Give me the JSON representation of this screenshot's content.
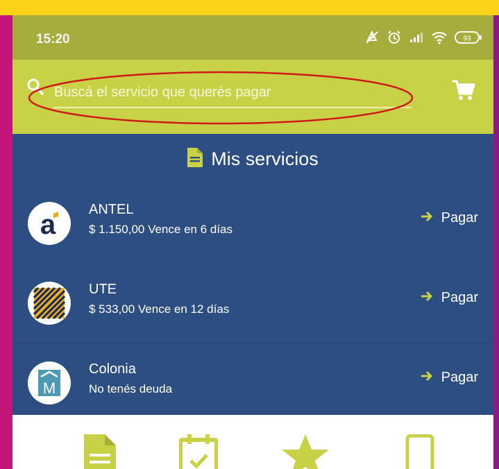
{
  "status_bar": {
    "time": "15:20",
    "battery_level": "93",
    "icons": [
      "mute-icon",
      "alarm-icon",
      "signal-icon",
      "wifi-icon",
      "battery-icon"
    ]
  },
  "search": {
    "placeholder": "Buscá el servicio que querés pagar",
    "icon": "search-icon",
    "cart_icon": "cart-icon"
  },
  "section": {
    "title": "Mis servicios",
    "icon": "document-icon"
  },
  "services": [
    {
      "name": "ANTEL",
      "status": "$ 1.150,00 Vence en 6 días",
      "action": "Pagar",
      "logo_letter": "a"
    },
    {
      "name": "UTE",
      "status": "$ 533,00 Vence en 12 días",
      "action": "Pagar"
    },
    {
      "name": "Colonia",
      "status": "No tenés deuda",
      "action": "Pagar",
      "logo_letter": "M"
    }
  ],
  "bottom_nav": {
    "items": [
      "document-icon",
      "calendar-icon",
      "star-icon",
      "phone-icon"
    ]
  },
  "colors": {
    "accent": "#c9d146",
    "status_bar": "#a6ad3c",
    "background": "#2c4e82",
    "highlight": "#d01919"
  }
}
